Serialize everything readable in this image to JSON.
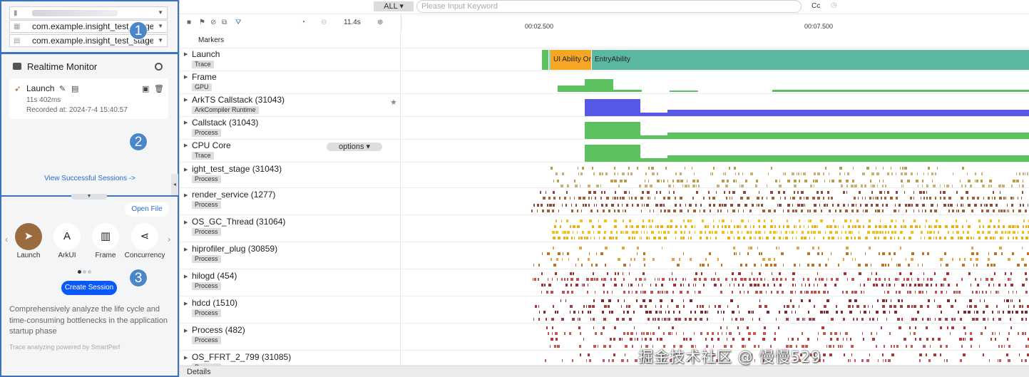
{
  "device_selectors": [
    {
      "value": "",
      "icon": "phone-icon"
    },
    {
      "value": "com.example.insight_test_stage",
      "icon": "app-grid-icon"
    },
    {
      "value": "com.example.insight_test_stage",
      "icon": "process-icon"
    }
  ],
  "badges": [
    "1",
    "2",
    "3"
  ],
  "realtime_monitor": {
    "title": "Realtime Monitor",
    "session": {
      "name": "Launch",
      "duration": "11s 402ms",
      "recorded_at": "Recorded at: 2024-7-4 15:40:57"
    },
    "link": "View Successful Sessions ->"
  },
  "templates": {
    "open_file": "Open File",
    "items": [
      {
        "label": "Launch",
        "icon": "rocket-icon",
        "glyph": "➤"
      },
      {
        "label": "ArkUI",
        "icon": "arkui-icon",
        "glyph": "A"
      },
      {
        "label": "Frame",
        "icon": "frame-icon",
        "glyph": "▥"
      },
      {
        "label": "Concurrency",
        "icon": "concurrency-icon",
        "glyph": "⋖"
      }
    ],
    "create_label": "Create Session",
    "description": "Comprehensively analyze the life cycle and time-consuming bottlenecks in the application startup phase",
    "powered": "Trace analyzing powered by SmartPerf"
  },
  "search": {
    "filter": "ALL",
    "placeholder": "Please Input Keyword",
    "case_label": "Cc"
  },
  "toolbar": {
    "zoom": "11.4s"
  },
  "timeline": {
    "ticks": [
      "00:02.500",
      "00:07.500"
    ]
  },
  "markers_label": "Markers",
  "options_label": "options",
  "rows": [
    {
      "name": "Launch",
      "tag": "Trace"
    },
    {
      "name": "Frame",
      "tag": "GPU"
    },
    {
      "name": "ArkTS Callstack (31043)",
      "tag": "ArkCompiler Runtime"
    },
    {
      "name": "Callstack (31043)",
      "tag": "Process"
    },
    {
      "name": "CPU Core",
      "tag": "Trace"
    },
    {
      "name": "ight_test_stage (31043)",
      "tag": "Process"
    },
    {
      "name": "render_service (1277)",
      "tag": "Process"
    },
    {
      "name": "OS_GC_Thread (31064)",
      "tag": "Process"
    },
    {
      "name": "hiprofiler_plug (30859)",
      "tag": "Process"
    },
    {
      "name": "hilogd (454)",
      "tag": "Process"
    },
    {
      "name": "hdcd (1510)",
      "tag": "Process"
    },
    {
      "name": "Process (482)",
      "tag": "Process"
    },
    {
      "name": "OS_FFRT_2_799 (31085)",
      "tag": "Process"
    }
  ],
  "launch_slices": [
    "UI Ability OnF...",
    "EntryAbility"
  ],
  "details_label": "Details",
  "watermark": "掘金技术社区 @ 慢慢529",
  "colors": {
    "accent_blue": "#0a59f7",
    "section_border": "#3b73c0",
    "launch_orange": "#f5a623",
    "entry_teal": "#5bb6a2",
    "gpu_green": "#5cc15f",
    "arkts_purple": "#5858e8"
  }
}
